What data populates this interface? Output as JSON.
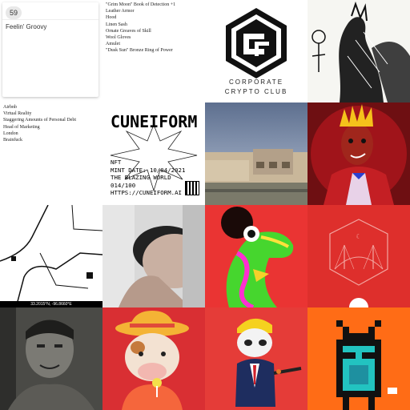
{
  "tiles": {
    "loot_card": {
      "badge": "59",
      "title": "Feelin' Groovy"
    },
    "loot_items": [
      "\"Grim Moon\" Book of Detection +1",
      "Leather Armor",
      "Hood",
      "Linen Sash",
      "Ornate Greaves of Skill",
      "Wool Gloves",
      "Amulet",
      "\"Dusk Sun\" Bronze Ring of Power"
    ],
    "profile_items": [
      "Airbnb",
      "Virtual Reality",
      "Staggering Amounts of Personal Debt",
      "Head of Marketing",
      "London",
      "Brainfuck"
    ],
    "corporate": {
      "line1": "CORPORATE",
      "line2": "CRYPTO CLUB"
    },
    "cuneiform": {
      "title": "CUNEIFORM",
      "lines": [
        "NFT",
        "MINT DATE: 10/04/2021",
        "THE BLAZING WORLD",
        "014/100",
        "HTTPS://CUNEIFORM.AI"
      ]
    },
    "map_caption": "33.2015°N, -96.8660°E"
  },
  "colors": {
    "red_bg": "#ea3433",
    "orange_bg": "#ff6c16",
    "chevron_bg": "#e03530",
    "green_llama": "#66ff33"
  }
}
